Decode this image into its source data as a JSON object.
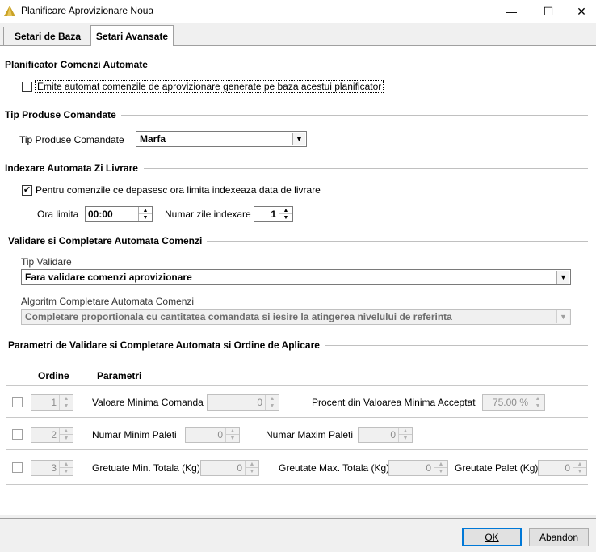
{
  "window": {
    "title": "Planificare Aprovizionare Noua",
    "minimize_glyph": "—",
    "maximize_glyph": "☐",
    "close_glyph": "✕"
  },
  "tabs": [
    {
      "label": "Setari de Baza"
    },
    {
      "label": "Setari Avansate"
    }
  ],
  "section_auto_orders": {
    "title": "Planificator Comenzi Automate",
    "checkbox_label": "Emite automat comenzile de aprovizionare generate pe baza acestui planificator",
    "checked": false
  },
  "section_product_type": {
    "title": "Tip Produse Comandate",
    "field_label": "Tip Produse Comandate",
    "value": "Marfa"
  },
  "section_delivery_index": {
    "title": "Indexare Automata Zi Livrare",
    "checkbox_label": "Pentru comenzile ce depasesc ora limita indexeaza data de livrare",
    "checked": true,
    "check_glyph": "✔",
    "time_limit_label": "Ora limita",
    "time_limit_value": "00:00",
    "days_label": "Numar zile indexare",
    "days_value": "1"
  },
  "section_validation": {
    "title": "Validare si Completare Automata Comenzi",
    "type_label": "Tip Validare",
    "type_value": "Fara validare comenzi aprovizionare",
    "algo_label": "Algoritm Completare Automata Comenzi",
    "algo_value": "Completare proportionala cu cantitatea comandata si iesire la atingerea nivelului de referinta"
  },
  "section_params": {
    "title": "Parametri de Validare si Completare Automata si Ordine de Aplicare",
    "col_order": "Ordine",
    "col_params": "Parametri",
    "rows": [
      {
        "order": "1",
        "params": [
          {
            "label": "Valoare Minima Comanda",
            "value": "0"
          },
          {
            "label": "Procent din Valoarea Minima Acceptat",
            "value": "75.00 %"
          }
        ]
      },
      {
        "order": "2",
        "params": [
          {
            "label": "Numar Minim Paleti",
            "value": "0"
          },
          {
            "label": "Numar Maxim Paleti",
            "value": "0"
          }
        ]
      },
      {
        "order": "3",
        "params": [
          {
            "label": "Gretuate Min. Totala (Kg)",
            "value": "0"
          },
          {
            "label": "Greutate Max. Totala (Kg)",
            "value": "0"
          },
          {
            "label": "Greutate Palet (Kg)",
            "value": "0"
          }
        ]
      }
    ]
  },
  "footer": {
    "ok_label": "OK",
    "cancel_label": "Abandon"
  },
  "icons": {
    "dropdown": "▼",
    "spin_up": "▲",
    "spin_down": "▼"
  }
}
